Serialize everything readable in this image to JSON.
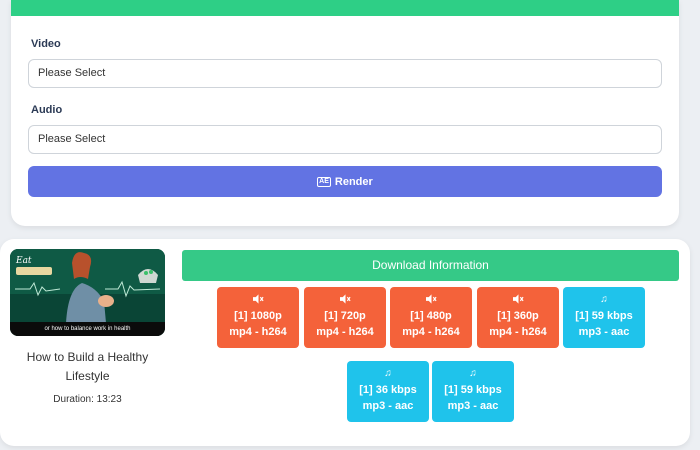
{
  "form": {
    "video_label": "Video",
    "video_placeholder": "Please Select",
    "audio_label": "Audio",
    "audio_placeholder": "Please Select",
    "render_label": "Render",
    "render_icon_text": "AE"
  },
  "video": {
    "thumbnail_caption": "or how to balance work in health",
    "title": "How to Build a Healthy Lifestyle",
    "duration": "Duration: 13:23"
  },
  "download": {
    "header": "Download Information",
    "video_formats": [
      {
        "line1": "[1] 1080p",
        "line2": "mp4 - h264"
      },
      {
        "line1": "[1] 720p",
        "line2": "mp4 - h264"
      },
      {
        "line1": "[1] 480p",
        "line2": "mp4 - h264"
      },
      {
        "line1": "[1] 360p",
        "line2": "mp4 - h264"
      }
    ],
    "audio_formats": [
      {
        "line1": "[1] 59 kbps",
        "line2": "mp3 - aac"
      },
      {
        "line1": "[1] 36 kbps",
        "line2": "mp3 - aac"
      },
      {
        "line1": "[1] 59 kbps",
        "line2": "mp3 - aac"
      }
    ]
  },
  "colors": {
    "accent_green": "#2ecf86",
    "render_blue": "#6273e3",
    "video_orange": "#f4623a",
    "audio_cyan": "#1fc3eb"
  },
  "icons": {
    "video_button_icon": "volume-mute-icon",
    "audio_button_icon": "music-note-icon"
  }
}
